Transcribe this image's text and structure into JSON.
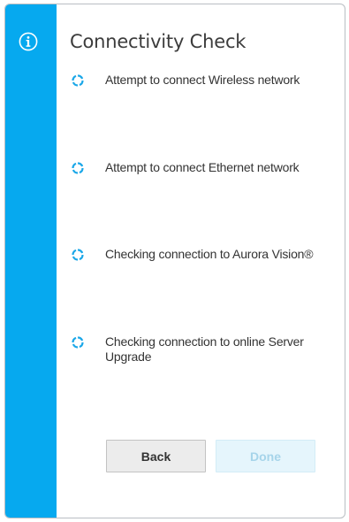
{
  "dialog": {
    "title": "Connectivity Check",
    "sidebar_icon": "info-icon",
    "accent_color": "#06a9ef"
  },
  "steps": [
    {
      "label": "Attempt to connect Wireless network",
      "status_icon": "loading-spinner-icon"
    },
    {
      "label": "Attempt to connect Ethernet network",
      "status_icon": "loading-spinner-icon"
    },
    {
      "label": "Checking connection to Aurora Vision®",
      "status_icon": "loading-spinner-icon"
    },
    {
      "label": "Checking connection to online Server Upgrade",
      "status_icon": "loading-spinner-icon"
    }
  ],
  "buttons": {
    "back_label": "Back",
    "done_label": "Done",
    "done_enabled": false
  }
}
